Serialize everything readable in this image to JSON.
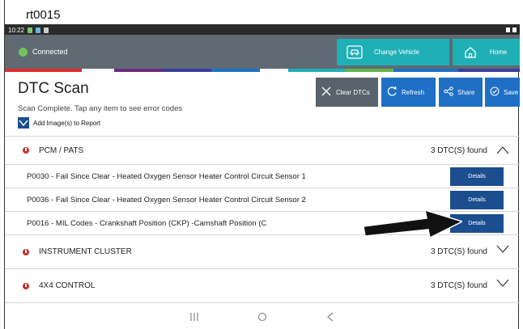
{
  "caption": "rt0015",
  "statusbar": {
    "time": "10:22"
  },
  "appbar": {
    "connection_label": "Connected",
    "change_vehicle_label": "Change Vehicle",
    "home_label": "Home"
  },
  "colors": {
    "appbar": "#606a73",
    "teal": "#1fb0b5",
    "blue": "#1e6fc5",
    "dark_blue": "#1b4e8f",
    "connected": "#73c35b",
    "warning": "#c62f2f"
  },
  "stripes": [
    "#e12d2b",
    "#6f2a7f",
    "#3b3f9b",
    "#1e6fc5",
    "#1fb0b5",
    "#63b34a",
    "#1e6fc5",
    "#3b3f9b"
  ],
  "page": {
    "title": "DTC Scan",
    "subtitle": "Scan Complete. Tap any item to see error codes",
    "add_images_label": "Add Image(s) to Report"
  },
  "toolbar": {
    "clear_label": "Clear DTCs",
    "refresh_label": "Refresh",
    "share_label": "Share",
    "save_label": "Save"
  },
  "groups": [
    {
      "name": "PCM / PATS",
      "found": "3 DTC(S) found",
      "expanded": true,
      "codes": [
        {
          "text": "P0030 - Fail Since Clear - Heated Oxygen Sensor Heater Control Circuit Sensor 1",
          "button": "Details"
        },
        {
          "text": "P0036 - Fail Since Clear - Heated Oxygen Sensor Heater Control Circuit Sensor 2",
          "button": "Details"
        },
        {
          "text": "P0016 - MIL Codes - Crankshaft Position (CKP) -Camshaft Position (C",
          "button": "Details"
        }
      ]
    },
    {
      "name": "INSTRUMENT CLUSTER",
      "found": "3 DTC(S) found",
      "expanded": false
    },
    {
      "name": "4X4 CONTROL",
      "found": "3 DTC(S) found",
      "expanded": false
    }
  ]
}
